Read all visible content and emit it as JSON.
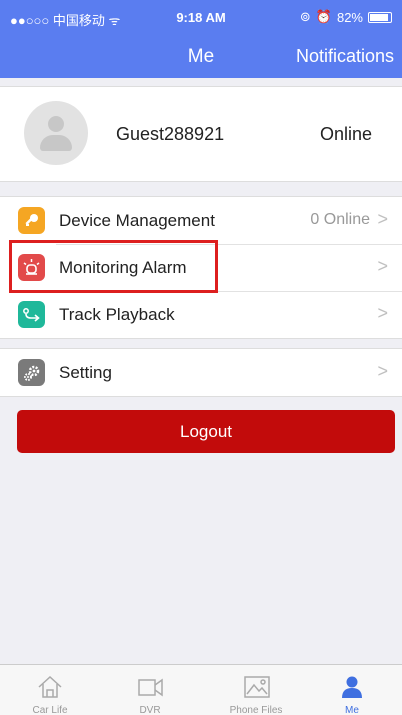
{
  "status_bar": {
    "carrier": "●●○○○ 中国移动 ᯤ",
    "time": "9:18 AM",
    "battery": "82%"
  },
  "nav": {
    "title": "Me",
    "right_button": "Notifications"
  },
  "profile": {
    "username": "Guest288921",
    "status": "Online"
  },
  "menu": {
    "device_management": {
      "label": "Device Management",
      "value": "0 Online",
      "icon": "key-icon",
      "color": "#f5a623"
    },
    "monitoring_alarm": {
      "label": "Monitoring Alarm",
      "icon": "alarm-light-icon",
      "color": "#e24a4a"
    },
    "track_playback": {
      "label": "Track Playback",
      "icon": "route-icon",
      "color": "#1fb89a"
    },
    "setting": {
      "label": "Setting",
      "icon": "gears-icon",
      "color": "#7a7a7a"
    }
  },
  "logout": {
    "label": "Logout"
  },
  "tabs": [
    {
      "label": "Car Life",
      "icon": "home-icon"
    },
    {
      "label": "DVR",
      "icon": "video-camera-icon"
    },
    {
      "label": "Phone Files",
      "icon": "image-icon"
    },
    {
      "label": "Me",
      "icon": "person-icon",
      "active": true
    }
  ],
  "colors": {
    "nav_bg": "#5a7df0",
    "logout_bg": "#c20b0b",
    "highlight": "#dd1f1f",
    "active_tab": "#3f6fe0"
  }
}
